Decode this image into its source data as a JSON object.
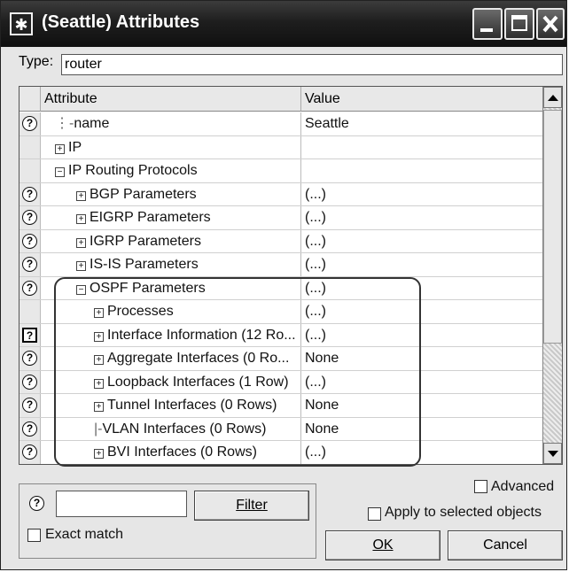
{
  "window": {
    "title": "(Seattle) Attributes",
    "icon": "asterisk-icon"
  },
  "type_bar": {
    "label": "Type:",
    "value": "router"
  },
  "table": {
    "headers": {
      "attribute": "Attribute",
      "value": "Value"
    },
    "rows": [
      {
        "attr": "name",
        "value": "Seattle",
        "help": true,
        "prefix": "tree-line",
        "indent": 0
      },
      {
        "attr": "IP",
        "value": "",
        "help": false,
        "prefix": "plus",
        "indent": 0
      },
      {
        "attr": "IP Routing Protocols",
        "value": "",
        "help": false,
        "prefix": "minus",
        "indent": 0
      },
      {
        "attr": "BGP Parameters",
        "value": "(...)",
        "help": true,
        "prefix": "plus",
        "indent": 1
      },
      {
        "attr": "EIGRP Parameters",
        "value": "(...)",
        "help": true,
        "prefix": "plus",
        "indent": 1
      },
      {
        "attr": "IGRP Parameters",
        "value": "(...)",
        "help": true,
        "prefix": "plus",
        "indent": 1
      },
      {
        "attr": "IS-IS Parameters",
        "value": "(...)",
        "help": true,
        "prefix": "plus",
        "indent": 1
      },
      {
        "attr": "OSPF Parameters",
        "value": "(...)",
        "help": true,
        "prefix": "minus",
        "indent": 1
      },
      {
        "attr": "Processes",
        "value": "(...)",
        "help": false,
        "prefix": "plus",
        "indent": 2
      },
      {
        "attr": "Interface Information (12 Ro...",
        "value": "(...)",
        "help": true,
        "selected": true,
        "prefix": "plus",
        "indent": 2
      },
      {
        "attr": "Aggregate Interfaces (0 Ro...",
        "value": "None",
        "help": true,
        "prefix": "plus",
        "indent": 2
      },
      {
        "attr": "Loopback Interfaces (1 Row)",
        "value": "(...)",
        "help": true,
        "prefix": "plus",
        "indent": 2
      },
      {
        "attr": "Tunnel Interfaces (0 Rows)",
        "value": "None",
        "help": true,
        "prefix": "plus",
        "indent": 2
      },
      {
        "attr": "VLAN Interfaces (0 Rows)",
        "value": "None",
        "help": true,
        "prefix": "tree-line",
        "indent": 2
      },
      {
        "attr": "BVI Interfaces (0 Rows)",
        "value": "(...)",
        "help": true,
        "prefix": "plus",
        "indent": 2
      }
    ]
  },
  "filter": {
    "help_icon": "question-icon",
    "input_value": "",
    "button_label": "Filter",
    "exact_match_label": "Exact match",
    "exact_match_checked": false
  },
  "options": {
    "advanced_label": "Advanced",
    "advanced_checked": false,
    "apply_label": "Apply to selected objects",
    "apply_checked": false
  },
  "buttons": {
    "ok": "OK",
    "cancel": "Cancel"
  }
}
